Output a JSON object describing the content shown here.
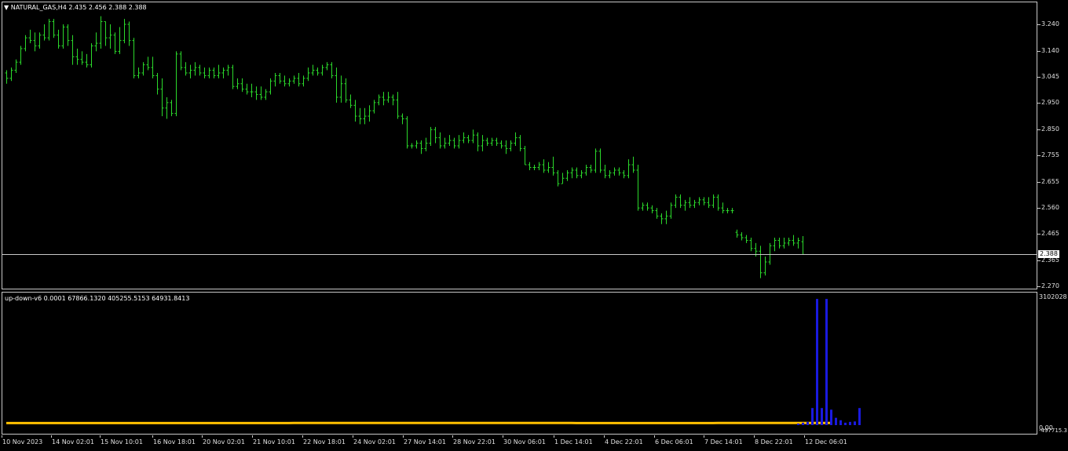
{
  "symbol_header": {
    "arrow": "▼",
    "text": "NATURAL_GAS,H4  2.435 2.456 2.388 2.388"
  },
  "indicator_header": {
    "text": "up-down-v6 0.0001 67866.1320 405255.5153 64931.8413"
  },
  "price_tag": "2.388",
  "colors": {
    "background": "#000000",
    "bar": "#2bd92b",
    "grid": "#c8c8c8",
    "volume": "#1a1adf",
    "signal": "#ffc000"
  },
  "price_axis": [
    "3.240",
    "3.140",
    "3.045",
    "2.950",
    "2.850",
    "2.755",
    "2.655",
    "2.560",
    "2.465",
    "2.365",
    "2.270"
  ],
  "indicator_axis": {
    "top": "3102028",
    "bottom_a": "0.00",
    "bottom_b": "-497715.3"
  },
  "time_axis": [
    "10 Nov 2023",
    "14 Nov 02:01",
    "15 Nov 10:01",
    "16 Nov 18:01",
    "20 Nov 02:01",
    "21 Nov 10:01",
    "22 Nov 18:01",
    "24 Nov 02:01",
    "27 Nov 14:01",
    "28 Nov 22:01",
    "30 Nov 06:01",
    "1 Dec 14:01",
    "4 Dec 22:01",
    "6 Dec 06:01",
    "7 Dec 14:01",
    "8 Dec 22:01",
    "12 Dec 06:01"
  ],
  "chart_data": {
    "type": "ohlc",
    "price_range": [
      2.27,
      3.29
    ],
    "bars": [
      [
        3.06,
        3.07,
        3.02,
        3.04
      ],
      [
        3.04,
        3.08,
        3.03,
        3.07
      ],
      [
        3.07,
        3.11,
        3.06,
        3.1
      ],
      [
        3.1,
        3.16,
        3.09,
        3.15
      ],
      [
        3.15,
        3.2,
        3.14,
        3.19
      ],
      [
        3.19,
        3.22,
        3.17,
        3.18
      ],
      [
        3.18,
        3.21,
        3.14,
        3.16
      ],
      [
        3.16,
        3.21,
        3.15,
        3.2
      ],
      [
        3.2,
        3.24,
        3.18,
        3.19
      ],
      [
        3.19,
        3.26,
        3.18,
        3.25
      ],
      [
        3.25,
        3.26,
        3.19,
        3.2
      ],
      [
        3.2,
        3.22,
        3.15,
        3.16
      ],
      [
        3.16,
        3.24,
        3.15,
        3.23
      ],
      [
        3.23,
        3.24,
        3.16,
        3.18
      ],
      [
        3.18,
        3.2,
        3.09,
        3.12
      ],
      [
        3.12,
        3.15,
        3.09,
        3.11
      ],
      [
        3.11,
        3.14,
        3.09,
        3.1
      ],
      [
        3.1,
        3.13,
        3.08,
        3.09
      ],
      [
        3.09,
        3.17,
        3.08,
        3.16
      ],
      [
        3.16,
        3.21,
        3.14,
        3.17
      ],
      [
        3.17,
        3.27,
        3.15,
        3.25
      ],
      [
        3.25,
        3.25,
        3.16,
        3.19
      ],
      [
        3.19,
        3.24,
        3.15,
        3.2
      ],
      [
        3.2,
        3.21,
        3.13,
        3.14
      ],
      [
        3.14,
        3.23,
        3.13,
        3.18
      ],
      [
        3.18,
        3.26,
        3.17,
        3.24
      ],
      [
        3.24,
        3.25,
        3.16,
        3.18
      ],
      [
        3.18,
        3.19,
        3.04,
        3.05
      ],
      [
        3.05,
        3.08,
        3.04,
        3.06
      ],
      [
        3.06,
        3.1,
        3.05,
        3.09
      ],
      [
        3.09,
        3.12,
        3.07,
        3.08
      ],
      [
        3.08,
        3.12,
        3.04,
        3.05
      ],
      [
        3.05,
        3.06,
        2.98,
        3.0
      ],
      [
        3.0,
        3.04,
        2.9,
        2.93
      ],
      [
        2.93,
        2.97,
        2.89,
        2.95
      ],
      [
        2.95,
        2.96,
        2.9,
        2.91
      ],
      [
        2.91,
        3.14,
        2.9,
        3.13
      ],
      [
        3.13,
        3.14,
        3.07,
        3.08
      ],
      [
        3.08,
        3.1,
        3.05,
        3.06
      ],
      [
        3.06,
        3.09,
        3.04,
        3.07
      ],
      [
        3.07,
        3.1,
        3.05,
        3.08
      ],
      [
        3.08,
        3.09,
        3.05,
        3.06
      ],
      [
        3.06,
        3.08,
        3.04,
        3.05
      ],
      [
        3.05,
        3.08,
        3.04,
        3.07
      ],
      [
        3.07,
        3.08,
        3.04,
        3.05
      ],
      [
        3.05,
        3.09,
        3.04,
        3.06
      ],
      [
        3.06,
        3.08,
        3.04,
        3.07
      ],
      [
        3.07,
        3.09,
        3.05,
        3.08
      ],
      [
        3.08,
        3.09,
        3.0,
        3.01
      ],
      [
        3.01,
        3.04,
        3.0,
        3.02
      ],
      [
        3.02,
        3.04,
        2.99,
        3.0
      ],
      [
        3.0,
        3.02,
        2.98,
        2.99
      ],
      [
        2.99,
        3.02,
        2.97,
        2.99
      ],
      [
        2.99,
        3.01,
        2.96,
        2.98
      ],
      [
        2.98,
        3.01,
        2.96,
        2.97
      ],
      [
        2.97,
        3.0,
        2.96,
        2.99
      ],
      [
        2.99,
        3.04,
        2.98,
        3.03
      ],
      [
        3.03,
        3.06,
        3.01,
        3.05
      ],
      [
        3.05,
        3.06,
        3.02,
        3.03
      ],
      [
        3.03,
        3.05,
        3.01,
        3.02
      ],
      [
        3.02,
        3.04,
        3.01,
        3.03
      ],
      [
        3.03,
        3.05,
        3.02,
        3.04
      ],
      [
        3.04,
        3.06,
        3.01,
        3.02
      ],
      [
        3.02,
        3.05,
        3.01,
        3.04
      ],
      [
        3.04,
        3.08,
        3.03,
        3.06
      ],
      [
        3.06,
        3.09,
        3.05,
        3.07
      ],
      [
        3.07,
        3.08,
        3.05,
        3.06
      ],
      [
        3.06,
        3.09,
        3.05,
        3.08
      ],
      [
        3.08,
        3.1,
        3.07,
        3.09
      ],
      [
        3.09,
        3.1,
        3.04,
        3.05
      ],
      [
        3.05,
        3.08,
        2.95,
        2.97
      ],
      [
        2.97,
        3.05,
        2.95,
        3.02
      ],
      [
        3.02,
        3.04,
        2.95,
        2.96
      ],
      [
        2.96,
        2.98,
        2.93,
        2.94
      ],
      [
        2.94,
        2.96,
        2.88,
        2.9
      ],
      [
        2.9,
        2.93,
        2.87,
        2.89
      ],
      [
        2.89,
        2.93,
        2.87,
        2.9
      ],
      [
        2.9,
        2.94,
        2.88,
        2.92
      ],
      [
        2.92,
        2.96,
        2.91,
        2.95
      ],
      [
        2.95,
        2.98,
        2.94,
        2.97
      ],
      [
        2.97,
        2.99,
        2.94,
        2.96
      ],
      [
        2.96,
        2.99,
        2.95,
        2.97
      ],
      [
        2.97,
        2.98,
        2.94,
        2.96
      ],
      [
        2.96,
        2.99,
        2.89,
        2.9
      ],
      [
        2.9,
        2.91,
        2.87,
        2.89
      ],
      [
        2.89,
        2.9,
        2.78,
        2.79
      ],
      [
        2.79,
        2.8,
        2.78,
        2.79
      ],
      [
        2.79,
        2.81,
        2.78,
        2.8
      ],
      [
        2.8,
        2.81,
        2.76,
        2.78
      ],
      [
        2.78,
        2.82,
        2.77,
        2.8
      ],
      [
        2.8,
        2.86,
        2.79,
        2.85
      ],
      [
        2.85,
        2.86,
        2.8,
        2.82
      ],
      [
        2.82,
        2.84,
        2.78,
        2.79
      ],
      [
        2.79,
        2.82,
        2.78,
        2.8
      ],
      [
        2.8,
        2.83,
        2.79,
        2.81
      ],
      [
        2.81,
        2.82,
        2.78,
        2.79
      ],
      [
        2.79,
        2.83,
        2.78,
        2.81
      ],
      [
        2.81,
        2.84,
        2.8,
        2.82
      ],
      [
        2.82,
        2.83,
        2.8,
        2.81
      ],
      [
        2.81,
        2.85,
        2.8,
        2.83
      ],
      [
        2.83,
        2.84,
        2.77,
        2.79
      ],
      [
        2.79,
        2.83,
        2.77,
        2.81
      ],
      [
        2.81,
        2.82,
        2.79,
        2.8
      ],
      [
        2.8,
        2.82,
        2.79,
        2.81
      ],
      [
        2.81,
        2.82,
        2.79,
        2.8
      ],
      [
        2.8,
        2.81,
        2.78,
        2.79
      ],
      [
        2.79,
        2.81,
        2.76,
        2.78
      ],
      [
        2.78,
        2.81,
        2.77,
        2.8
      ],
      [
        2.8,
        2.84,
        2.79,
        2.82
      ],
      [
        2.82,
        2.83,
        2.77,
        2.78
      ],
      [
        2.78,
        2.79,
        2.72,
        2.72
      ],
      [
        2.72,
        2.73,
        2.7,
        2.71
      ],
      [
        2.71,
        2.72,
        2.7,
        2.71
      ],
      [
        2.71,
        2.73,
        2.7,
        2.72
      ],
      [
        2.72,
        2.74,
        2.69,
        2.7
      ],
      [
        2.7,
        2.73,
        2.69,
        2.71
      ],
      [
        2.71,
        2.75,
        2.68,
        2.69
      ],
      [
        2.69,
        2.7,
        2.64,
        2.65
      ],
      [
        2.65,
        2.69,
        2.65,
        2.67
      ],
      [
        2.67,
        2.7,
        2.66,
        2.69
      ],
      [
        2.69,
        2.71,
        2.67,
        2.7
      ],
      [
        2.7,
        2.71,
        2.67,
        2.68
      ],
      [
        2.68,
        2.7,
        2.67,
        2.69
      ],
      [
        2.69,
        2.72,
        2.68,
        2.71
      ],
      [
        2.71,
        2.72,
        2.69,
        2.7
      ],
      [
        2.7,
        2.78,
        2.69,
        2.77
      ],
      [
        2.77,
        2.78,
        2.69,
        2.7
      ],
      [
        2.7,
        2.72,
        2.67,
        2.68
      ],
      [
        2.68,
        2.7,
        2.67,
        2.69
      ],
      [
        2.69,
        2.71,
        2.68,
        2.7
      ],
      [
        2.7,
        2.71,
        2.68,
        2.69
      ],
      [
        2.69,
        2.7,
        2.67,
        2.68
      ],
      [
        2.68,
        2.74,
        2.67,
        2.72
      ],
      [
        2.72,
        2.75,
        2.69,
        2.7
      ],
      [
        2.7,
        2.72,
        2.55,
        2.56
      ],
      [
        2.56,
        2.58,
        2.55,
        2.57
      ],
      [
        2.57,
        2.58,
        2.55,
        2.56
      ],
      [
        2.56,
        2.57,
        2.54,
        2.55
      ],
      [
        2.55,
        2.56,
        2.52,
        2.53
      ],
      [
        2.53,
        2.54,
        2.5,
        2.52
      ],
      [
        2.52,
        2.55,
        2.5,
        2.53
      ],
      [
        2.53,
        2.58,
        2.52,
        2.57
      ],
      [
        2.57,
        2.61,
        2.56,
        2.6
      ],
      [
        2.6,
        2.61,
        2.56,
        2.57
      ],
      [
        2.57,
        2.59,
        2.55,
        2.58
      ],
      [
        2.58,
        2.6,
        2.56,
        2.57
      ],
      [
        2.57,
        2.59,
        2.56,
        2.58
      ],
      [
        2.58,
        2.6,
        2.57,
        2.59
      ],
      [
        2.59,
        2.6,
        2.57,
        2.58
      ],
      [
        2.58,
        2.6,
        2.56,
        2.57
      ],
      [
        2.57,
        2.61,
        2.56,
        2.6
      ],
      [
        2.6,
        2.61,
        2.55,
        2.56
      ],
      [
        2.56,
        2.58,
        2.54,
        2.55
      ],
      [
        2.55,
        2.56,
        2.54,
        2.55
      ],
      [
        2.55,
        2.56,
        2.54,
        2.55
      ],
      [
        2.47,
        2.48,
        2.45,
        2.46
      ],
      [
        2.46,
        2.47,
        2.44,
        2.45
      ],
      [
        2.45,
        2.46,
        2.43,
        2.44
      ],
      [
        2.44,
        2.45,
        2.4,
        2.41
      ],
      [
        2.41,
        2.43,
        2.38,
        2.4
      ],
      [
        2.4,
        2.42,
        2.3,
        2.32
      ],
      [
        2.32,
        2.38,
        2.31,
        2.36
      ],
      [
        2.36,
        2.43,
        2.35,
        2.42
      ],
      [
        2.42,
        2.45,
        2.4,
        2.44
      ],
      [
        2.44,
        2.45,
        2.41,
        2.42
      ],
      [
        2.42,
        2.45,
        2.41,
        2.43
      ],
      [
        2.43,
        2.45,
        2.42,
        2.44
      ],
      [
        2.44,
        2.46,
        2.42,
        2.43
      ],
      [
        2.43,
        2.45,
        2.41,
        2.44
      ],
      [
        2.435,
        2.456,
        2.388,
        2.388
      ]
    ],
    "indicator_range": [
      -497715.3,
      3102028
    ],
    "volume_values": [
      0,
      0,
      0,
      0,
      0,
      0,
      0,
      0,
      0,
      0,
      0,
      0,
      0,
      0,
      0,
      0,
      0,
      0,
      0,
      0,
      0,
      0,
      0,
      0,
      0,
      0,
      0,
      0,
      0,
      0,
      0,
      0,
      0,
      0,
      0,
      0,
      0,
      0,
      0,
      0,
      0,
      0,
      0,
      0,
      0,
      0,
      0,
      0,
      0,
      0,
      0,
      0,
      0,
      0,
      0,
      0,
      0,
      0,
      0,
      0,
      0,
      0,
      0,
      0,
      0,
      0,
      0,
      0,
      0,
      0,
      0,
      0,
      0,
      0,
      0,
      0,
      0,
      0,
      0,
      0,
      0,
      0,
      0,
      0,
      0,
      0,
      0,
      0,
      0,
      0,
      0,
      0,
      0,
      0,
      0,
      0,
      0,
      0,
      0,
      0,
      0,
      0,
      0,
      0,
      0,
      0,
      0,
      0,
      0,
      0,
      0,
      0,
      0,
      0,
      0,
      0,
      0,
      0,
      0,
      0,
      0,
      0,
      0,
      0,
      0,
      0,
      0,
      0,
      0,
      0,
      0,
      0,
      0,
      0,
      0,
      0,
      0,
      0,
      0,
      0,
      0,
      0,
      0,
      0,
      0,
      0,
      0,
      0,
      0,
      0,
      0,
      0,
      0,
      0,
      0,
      0,
      0,
      0,
      0,
      0,
      0,
      0,
      0,
      0,
      0,
      0,
      0,
      0,
      40000,
      60000,
      80000,
      420000,
      3100000,
      420000,
      3100000,
      380000,
      180000,
      120000,
      60000,
      80000,
      90000,
      420000
    ],
    "signal_line": [
      [
        0,
        50000
      ],
      [
        60,
        50000
      ],
      [
        61,
        54000
      ],
      [
        120,
        54000
      ],
      [
        121,
        50000
      ],
      [
        150,
        50000
      ],
      [
        151,
        54000
      ],
      [
        175,
        54000
      ]
    ]
  }
}
